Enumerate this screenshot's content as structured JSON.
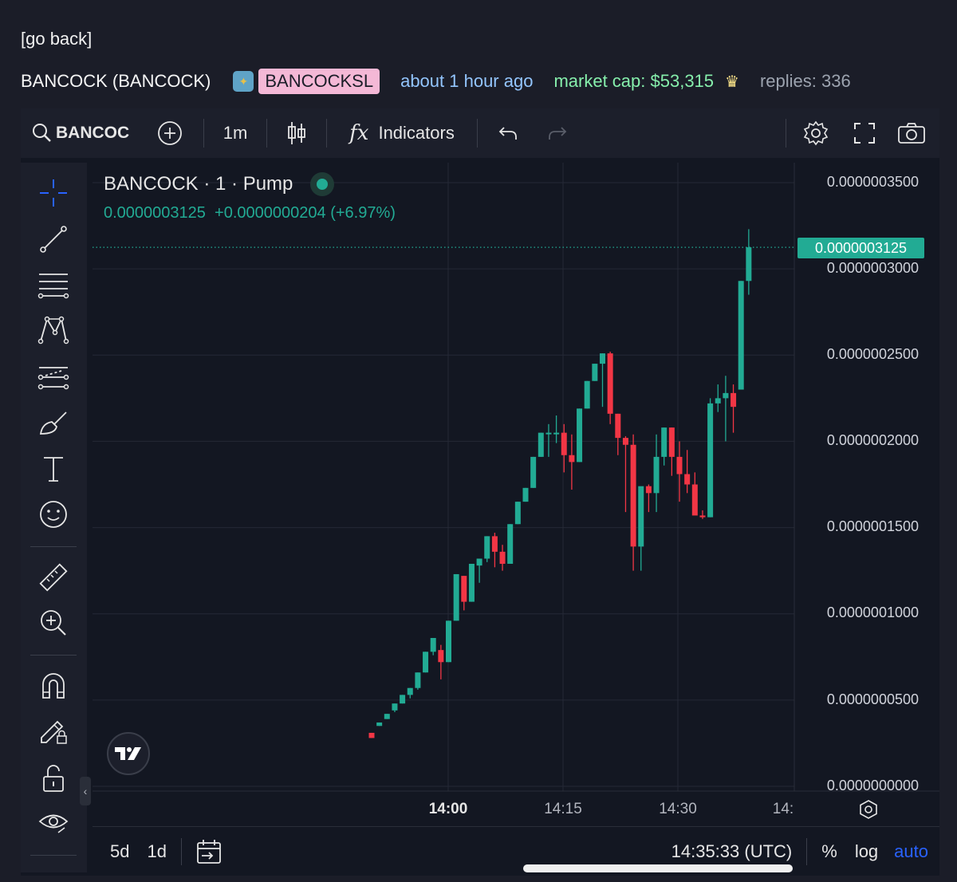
{
  "nav": {
    "go_back": "[go back]"
  },
  "header": {
    "token_name": "BANCOCK (BANCOCK)",
    "ticker": "BANCOCKSL",
    "time_ago": "about 1 hour ago",
    "market_cap": "market cap: $53,315",
    "replies": "replies: 336"
  },
  "toolbar": {
    "symbol": "BANCOC",
    "interval": "1m",
    "indicators": "Indicators"
  },
  "legend": {
    "title": "BANCOCK · 1 · Pump",
    "price": "0.0000003125",
    "change": "+0.0000000204 (+6.97%)"
  },
  "price_axis": {
    "labels": [
      "0.0000003500",
      "0.0000003000",
      "0.0000002500",
      "0.0000002000",
      "0.0000001500",
      "0.0000001000",
      "0.0000000500",
      "0.0000000000"
    ],
    "current": "0.0000003125"
  },
  "time_axis": {
    "labels": [
      "14:00",
      "14:15",
      "14:30",
      "14:"
    ]
  },
  "bottom": {
    "range_5d": "5d",
    "range_1d": "1d",
    "clock": "14:35:33 (UTC)",
    "percent": "%",
    "log": "log",
    "auto": "auto"
  },
  "colors": {
    "up": "#22ab94",
    "down": "#f23645",
    "background": "#131722",
    "accent": "#2962ff"
  },
  "chart_data": {
    "type": "candlestick",
    "ylim": [
      0,
      3.5e-07
    ],
    "candles": [
      {
        "o": 0.31,
        "h": 0.31,
        "l": 0.28,
        "c": 0.28
      },
      {
        "o": 0.35,
        "h": 0.37,
        "l": 0.35,
        "c": 0.37
      },
      {
        "o": 0.39,
        "h": 0.42,
        "l": 0.39,
        "c": 0.42
      },
      {
        "o": 0.44,
        "h": 0.48,
        "l": 0.43,
        "c": 0.48
      },
      {
        "o": 0.48,
        "h": 0.53,
        "l": 0.48,
        "c": 0.53
      },
      {
        "o": 0.53,
        "h": 0.57,
        "l": 0.51,
        "c": 0.57
      },
      {
        "o": 0.57,
        "h": 0.66,
        "l": 0.56,
        "c": 0.66
      },
      {
        "o": 0.66,
        "h": 0.78,
        "l": 0.66,
        "c": 0.78
      },
      {
        "o": 0.78,
        "h": 0.86,
        "l": 0.76,
        "c": 0.86
      },
      {
        "o": 0.79,
        "h": 0.82,
        "l": 0.62,
        "c": 0.72
      },
      {
        "o": 0.72,
        "h": 0.96,
        "l": 0.72,
        "c": 0.96
      },
      {
        "o": 0.96,
        "h": 1.23,
        "l": 0.96,
        "c": 1.23
      },
      {
        "o": 1.22,
        "h": 1.22,
        "l": 1.02,
        "c": 1.07
      },
      {
        "o": 1.07,
        "h": 1.29,
        "l": 1.07,
        "c": 1.29
      },
      {
        "o": 1.28,
        "h": 1.32,
        "l": 1.18,
        "c": 1.32
      },
      {
        "o": 1.32,
        "h": 1.45,
        "l": 1.3,
        "c": 1.45
      },
      {
        "o": 1.45,
        "h": 1.47,
        "l": 1.27,
        "c": 1.36
      },
      {
        "o": 1.36,
        "h": 1.4,
        "l": 1.25,
        "c": 1.29
      },
      {
        "o": 1.29,
        "h": 1.52,
        "l": 1.29,
        "c": 1.52
      },
      {
        "o": 1.52,
        "h": 1.65,
        "l": 1.52,
        "c": 1.65
      },
      {
        "o": 1.65,
        "h": 1.73,
        "l": 1.65,
        "c": 1.73
      },
      {
        "o": 1.73,
        "h": 1.91,
        "l": 1.73,
        "c": 1.91
      },
      {
        "o": 1.91,
        "h": 2.05,
        "l": 1.91,
        "c": 2.05
      },
      {
        "o": 2.05,
        "h": 2.1,
        "l": 1.91,
        "c": 2.05
      },
      {
        "o": 2.05,
        "h": 2.15,
        "l": 1.99,
        "c": 2.05
      },
      {
        "o": 2.05,
        "h": 2.1,
        "l": 1.82,
        "c": 1.92
      },
      {
        "o": 1.92,
        "h": 2.04,
        "l": 1.72,
        "c": 1.88
      },
      {
        "o": 1.88,
        "h": 2.19,
        "l": 1.88,
        "c": 2.19
      },
      {
        "o": 2.19,
        "h": 2.35,
        "l": 2.19,
        "c": 2.35
      },
      {
        "o": 2.35,
        "h": 2.45,
        "l": 2.35,
        "c": 2.45
      },
      {
        "o": 2.45,
        "h": 2.51,
        "l": 2.2,
        "c": 2.51
      },
      {
        "o": 2.51,
        "h": 2.52,
        "l": 2.1,
        "c": 2.16
      },
      {
        "o": 2.16,
        "h": 2.16,
        "l": 1.92,
        "c": 2.02
      },
      {
        "o": 2.02,
        "h": 2.03,
        "l": 1.59,
        "c": 1.98
      },
      {
        "o": 1.98,
        "h": 2.04,
        "l": 1.25,
        "c": 1.39
      },
      {
        "o": 1.39,
        "h": 1.7,
        "l": 1.25,
        "c": 1.74
      },
      {
        "o": 1.74,
        "h": 1.75,
        "l": 1.59,
        "c": 1.7
      },
      {
        "o": 1.7,
        "h": 2.04,
        "l": 1.59,
        "c": 1.91
      },
      {
        "o": 1.91,
        "h": 2.08,
        "l": 1.86,
        "c": 2.08
      },
      {
        "o": 2.08,
        "h": 2.08,
        "l": 1.8,
        "c": 1.91
      },
      {
        "o": 1.91,
        "h": 2.0,
        "l": 1.65,
        "c": 1.81
      },
      {
        "o": 1.81,
        "h": 1.95,
        "l": 1.7,
        "c": 1.75
      },
      {
        "o": 1.75,
        "h": 1.82,
        "l": 1.6,
        "c": 1.57
      },
      {
        "o": 1.57,
        "h": 1.6,
        "l": 1.55,
        "c": 1.56
      },
      {
        "o": 1.56,
        "h": 2.25,
        "l": 1.56,
        "c": 2.22
      },
      {
        "o": 2.22,
        "h": 2.33,
        "l": 2.17,
        "c": 2.25
      },
      {
        "o": 2.25,
        "h": 2.38,
        "l": 2.0,
        "c": 2.28
      },
      {
        "o": 2.28,
        "h": 2.33,
        "l": 2.05,
        "c": 2.2
      },
      {
        "o": 2.3,
        "h": 2.93,
        "l": 2.3,
        "c": 2.93
      },
      {
        "o": 2.93,
        "h": 3.23,
        "l": 2.85,
        "c": 3.125
      }
    ],
    "unit_scale": 1e-07,
    "xlabel": "",
    "ylabel": ""
  }
}
